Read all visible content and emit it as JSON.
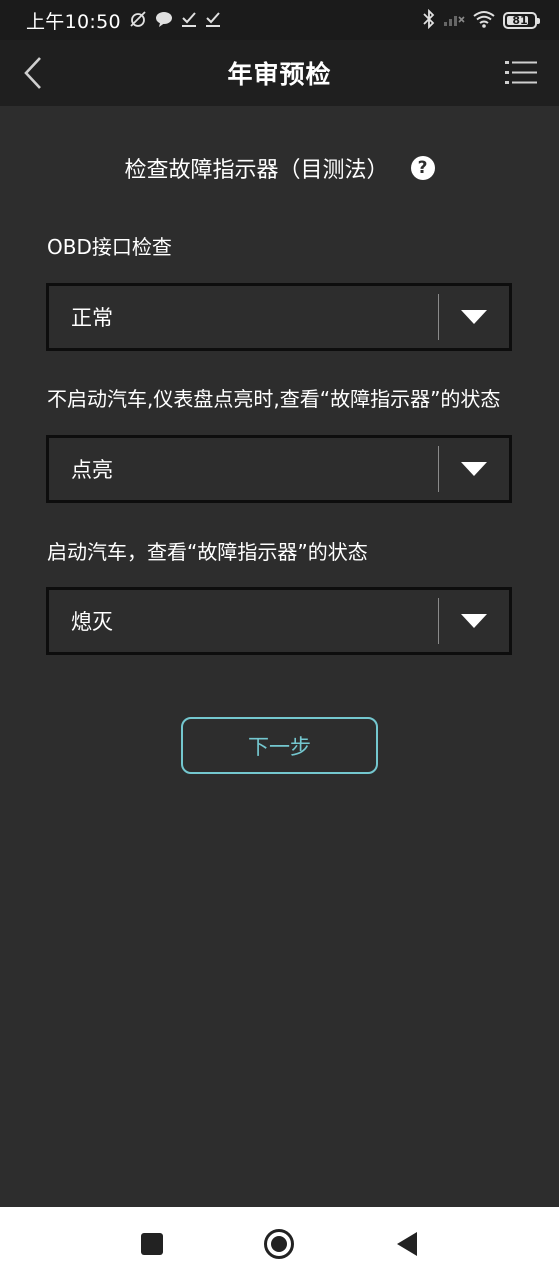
{
  "status_bar": {
    "time": "上午10:50",
    "battery": "81",
    "battery_level": 0.81,
    "icons": [
      "muted-alarm-icon",
      "chat-bubble-icon",
      "check-download-icon",
      "check-download-icon",
      "bluetooth-icon",
      "signal-icon",
      "wifi-icon",
      "battery-icon"
    ]
  },
  "header": {
    "title": "年审预检",
    "back_icon": "chevron-left-icon",
    "menu_icon": "list-menu-icon"
  },
  "section": {
    "title": "检查故障指示器（目测法）",
    "help_icon": "?"
  },
  "fields": [
    {
      "label": "OBD接口检查",
      "value": "正常"
    },
    {
      "label": "不启动汽车,仪表盘点亮时,查看“故障指示器”的状态",
      "value": "点亮"
    },
    {
      "label": "启动汽车，查看“故障指示器”的状态",
      "value": "熄灭"
    }
  ],
  "next_button": {
    "label": "下一步"
  },
  "colors": {
    "background": "#2d2d2d",
    "header": "#1f1f1f",
    "accent": "#74c7cf"
  },
  "nav_bar": {
    "icons": [
      "recent-apps-icon",
      "home-icon",
      "back-triangle-icon"
    ]
  }
}
